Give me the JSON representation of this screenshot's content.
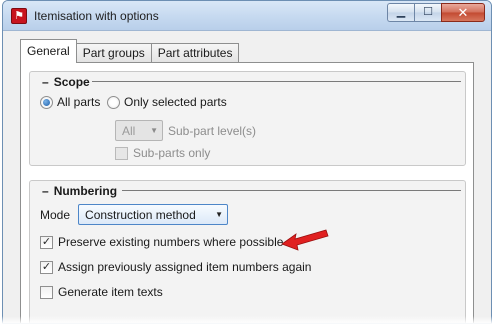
{
  "window": {
    "title": "Itemisation with options",
    "app_icon": "app-logo-icon",
    "controls": {
      "minimize": "minimize-icon",
      "maximize": "maximize-icon",
      "close": "close-icon"
    }
  },
  "tabs": [
    {
      "label": "General",
      "active": true
    },
    {
      "label": "Part groups",
      "active": false
    },
    {
      "label": "Part attributes",
      "active": false
    }
  ],
  "scope": {
    "title": "Scope",
    "options": [
      {
        "label": "All parts",
        "selected": true
      },
      {
        "label": "Only selected parts",
        "selected": false
      }
    ],
    "sublevel": {
      "value": "All",
      "label": "Sub-part level(s)",
      "enabled": false
    },
    "subparts_only": {
      "label": "Sub-parts only",
      "checked": false,
      "enabled": false
    }
  },
  "numbering": {
    "title": "Numbering",
    "mode_label": "Mode",
    "mode_value": "Construction method",
    "options": [
      {
        "label": "Preserve existing numbers where possible",
        "checked": true
      },
      {
        "label": "Assign previously assigned item numbers again",
        "checked": true
      },
      {
        "label": "Generate item texts",
        "checked": false
      }
    ]
  },
  "colors": {
    "titlebar": "#c4d8ef",
    "radio_dot": "#1c5ea8",
    "annotation_arrow": "#e02020"
  }
}
